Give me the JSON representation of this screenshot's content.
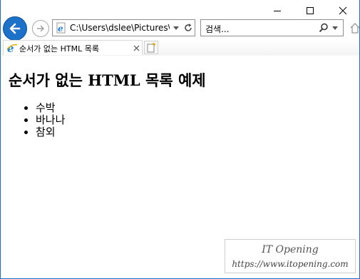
{
  "browser": {
    "address": "C:\\Users\\dslee\\Pictures\\",
    "search_placeholder": "검색...",
    "tab_title": "순서가 없는 HTML 목록"
  },
  "page": {
    "heading": "순서가 없는 HTML 목록 예제",
    "list": [
      "수박",
      "바나나",
      "참외"
    ]
  },
  "watermark": {
    "line1": "IT Opening",
    "line2": "https://www.itopening.com"
  },
  "colors": {
    "accent": "#1c71c9",
    "frame": "#1f6fc5"
  }
}
